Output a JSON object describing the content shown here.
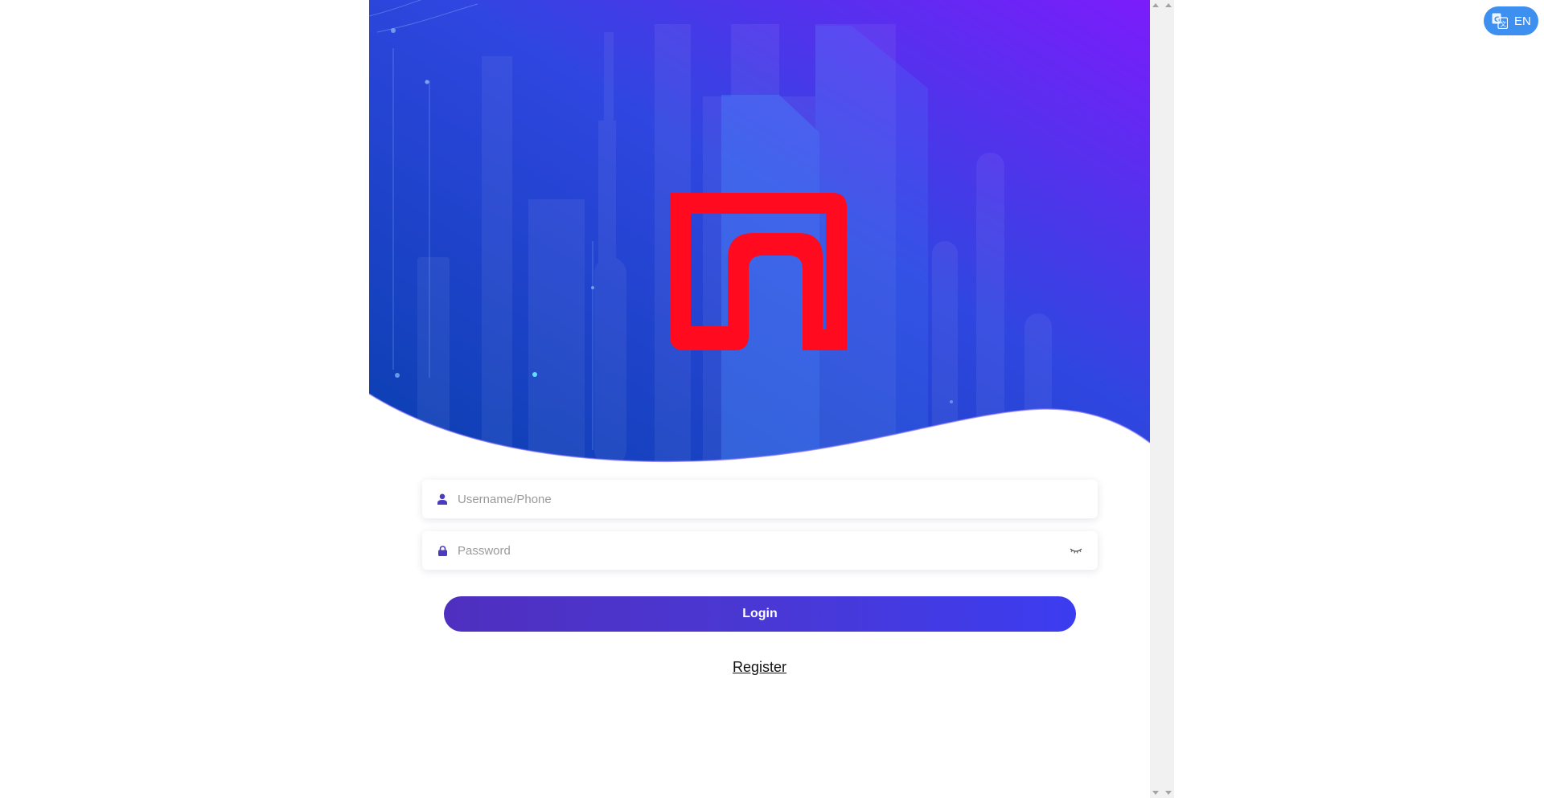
{
  "hero": {
    "logo_icon": "brand-logo-icon",
    "logo_color": "#ff0a1e",
    "gradient_colors": [
      "#0a3fb0",
      "#2f46e0",
      "#7b1cfb"
    ]
  },
  "form": {
    "username_placeholder": "Username/Phone",
    "username_icon": "user-icon",
    "password_placeholder": "Password",
    "password_icon": "lock-icon",
    "password_toggle_icon": "eye-closed-icon",
    "icon_color": "#4a3bbf"
  },
  "actions": {
    "login_label": "Login",
    "register_label": "Register"
  },
  "language": {
    "label": "EN",
    "icon": "translate-icon",
    "color": "#3d8ff0"
  }
}
